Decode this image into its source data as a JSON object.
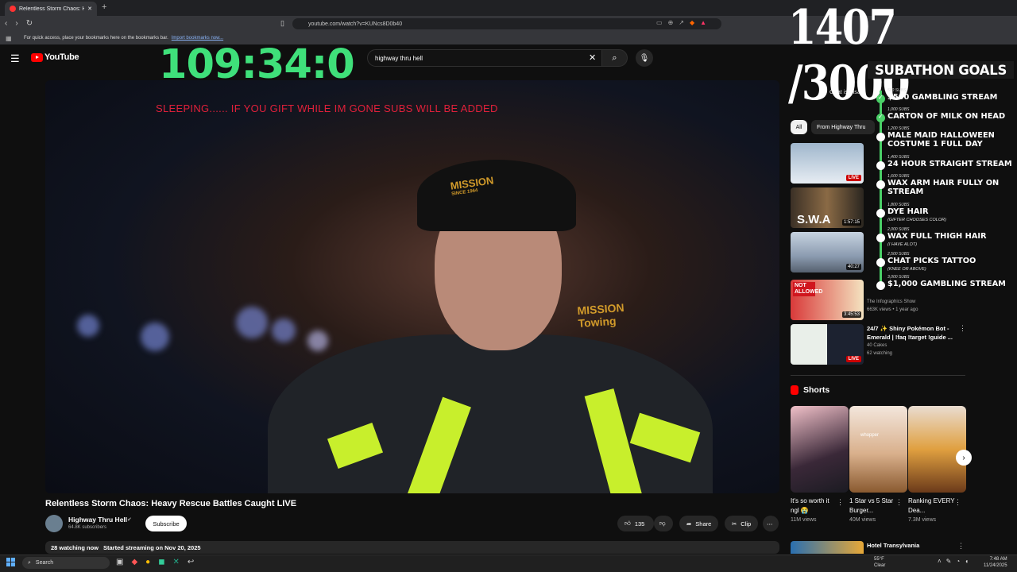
{
  "browser": {
    "tab_title": "Relentless Storm Chaos: Heav...",
    "url": "youtube.com/watch?v=KUNcs8D0b40",
    "bookmarks_hint": "For quick access, place your bookmarks here on the bookmarks bar.",
    "bookmarks_link": "Import bookmarks now..."
  },
  "header": {
    "logo_text": "YouTube",
    "search_value": "highway thru hell"
  },
  "overlay": {
    "timer": "109:34:0",
    "sleeping_text": "SLEEPING......  IF YOU GIFT WHILE IM GONE SUBS WILL BE ADDED",
    "counter": "1407 /3000",
    "goals_title": "SUBATHON GOALS",
    "goals": [
      {
        "subs": "500 SUBS",
        "name": "$500 GAMBLING STREAM",
        "note": "",
        "done": true
      },
      {
        "subs": "1,000 SUBS",
        "name": "CARTON OF MILK ON HEAD",
        "note": "",
        "done": true
      },
      {
        "subs": "1,200 SUBS",
        "name": "MALE MAID HALLOWEEN COSTUME 1 FULL DAY",
        "note": "",
        "done": false
      },
      {
        "subs": "1,400 SUBS",
        "name": "24 HOUR STRAIGHT STREAM",
        "note": "",
        "done": false
      },
      {
        "subs": "1,600 SUBS",
        "name": "WAX ARM HAIR FULLY ON STREAM",
        "note": "",
        "done": false
      },
      {
        "subs": "1,800 SUBS",
        "name": "DYE HAIR",
        "note": "(GIFTER CHOOSES COLOR)",
        "done": false
      },
      {
        "subs": "2,000 SUBS",
        "name": "WAX FULL THIGH HAIR",
        "note": "(I HAVE ALOT)",
        "done": false
      },
      {
        "subs": "2,500 SUBS",
        "name": "CHAT PICKS TATTOO",
        "note": "(KNEE OR ABOVE)",
        "done": false
      },
      {
        "subs": "3,000 SUBS",
        "name": "$1,000 GAMBLING STREAM",
        "note": "",
        "done": false
      }
    ]
  },
  "video": {
    "cap_text": "MISSION",
    "cap_sub": "SINCE 1964",
    "jacket_text": "MISSION Towing",
    "title": "Relentless Storm Chaos: Heavy Rescue Battles Caught LIVE",
    "channel": "Highway Thru Hell",
    "subscribers": "64.8K subscribers",
    "subscribe_label": "Subscribe",
    "likes": "135",
    "share_label": "Share",
    "clip_label": "Clip",
    "watching": "28 watching now",
    "started": "Started streaming on Nov 20, 2025"
  },
  "sidebar": {
    "chat_disabled": "Chat is disabl",
    "chip_all": "All",
    "chip_from": "From Highway Thru",
    "thumbs": [
      {
        "badge": "LIVE",
        "kind": "live"
      },
      {
        "badge": "1:57:15",
        "kind": "dur",
        "label": "S.W.A"
      },
      {
        "badge": "40:27",
        "kind": "dur"
      },
      {
        "badge": "3:45:53",
        "kind": "dur",
        "label": "NOT ALLOWED"
      },
      {
        "badge": "LIVE",
        "kind": "live"
      }
    ],
    "infographics_channel": "The Infographics Show",
    "infographics_meta": "663K views • 1 year ago",
    "pokemon_title": "24/7 ✨ Shiny Pokémon Bot - Emerald | !faq !target !guide ...",
    "pokemon_channel": "40 Cakes",
    "pokemon_meta": "62 watching",
    "shorts_label": "Shorts",
    "shorts": [
      {
        "title": "It's so worth it ngl 😭",
        "views": "11M views"
      },
      {
        "title": "1 Star vs 5 Star Burger...",
        "views": "40M views",
        "label": "whopper"
      },
      {
        "title": "Ranking EVERY Dea...",
        "views": "7.3M views"
      }
    ],
    "hotel_title": "Hotel Transylvania"
  },
  "taskbar": {
    "search": "Search",
    "weather_temp": "55°F",
    "weather_desc": "Clear",
    "time": "7:48 AM",
    "date": "11/24/2025"
  }
}
